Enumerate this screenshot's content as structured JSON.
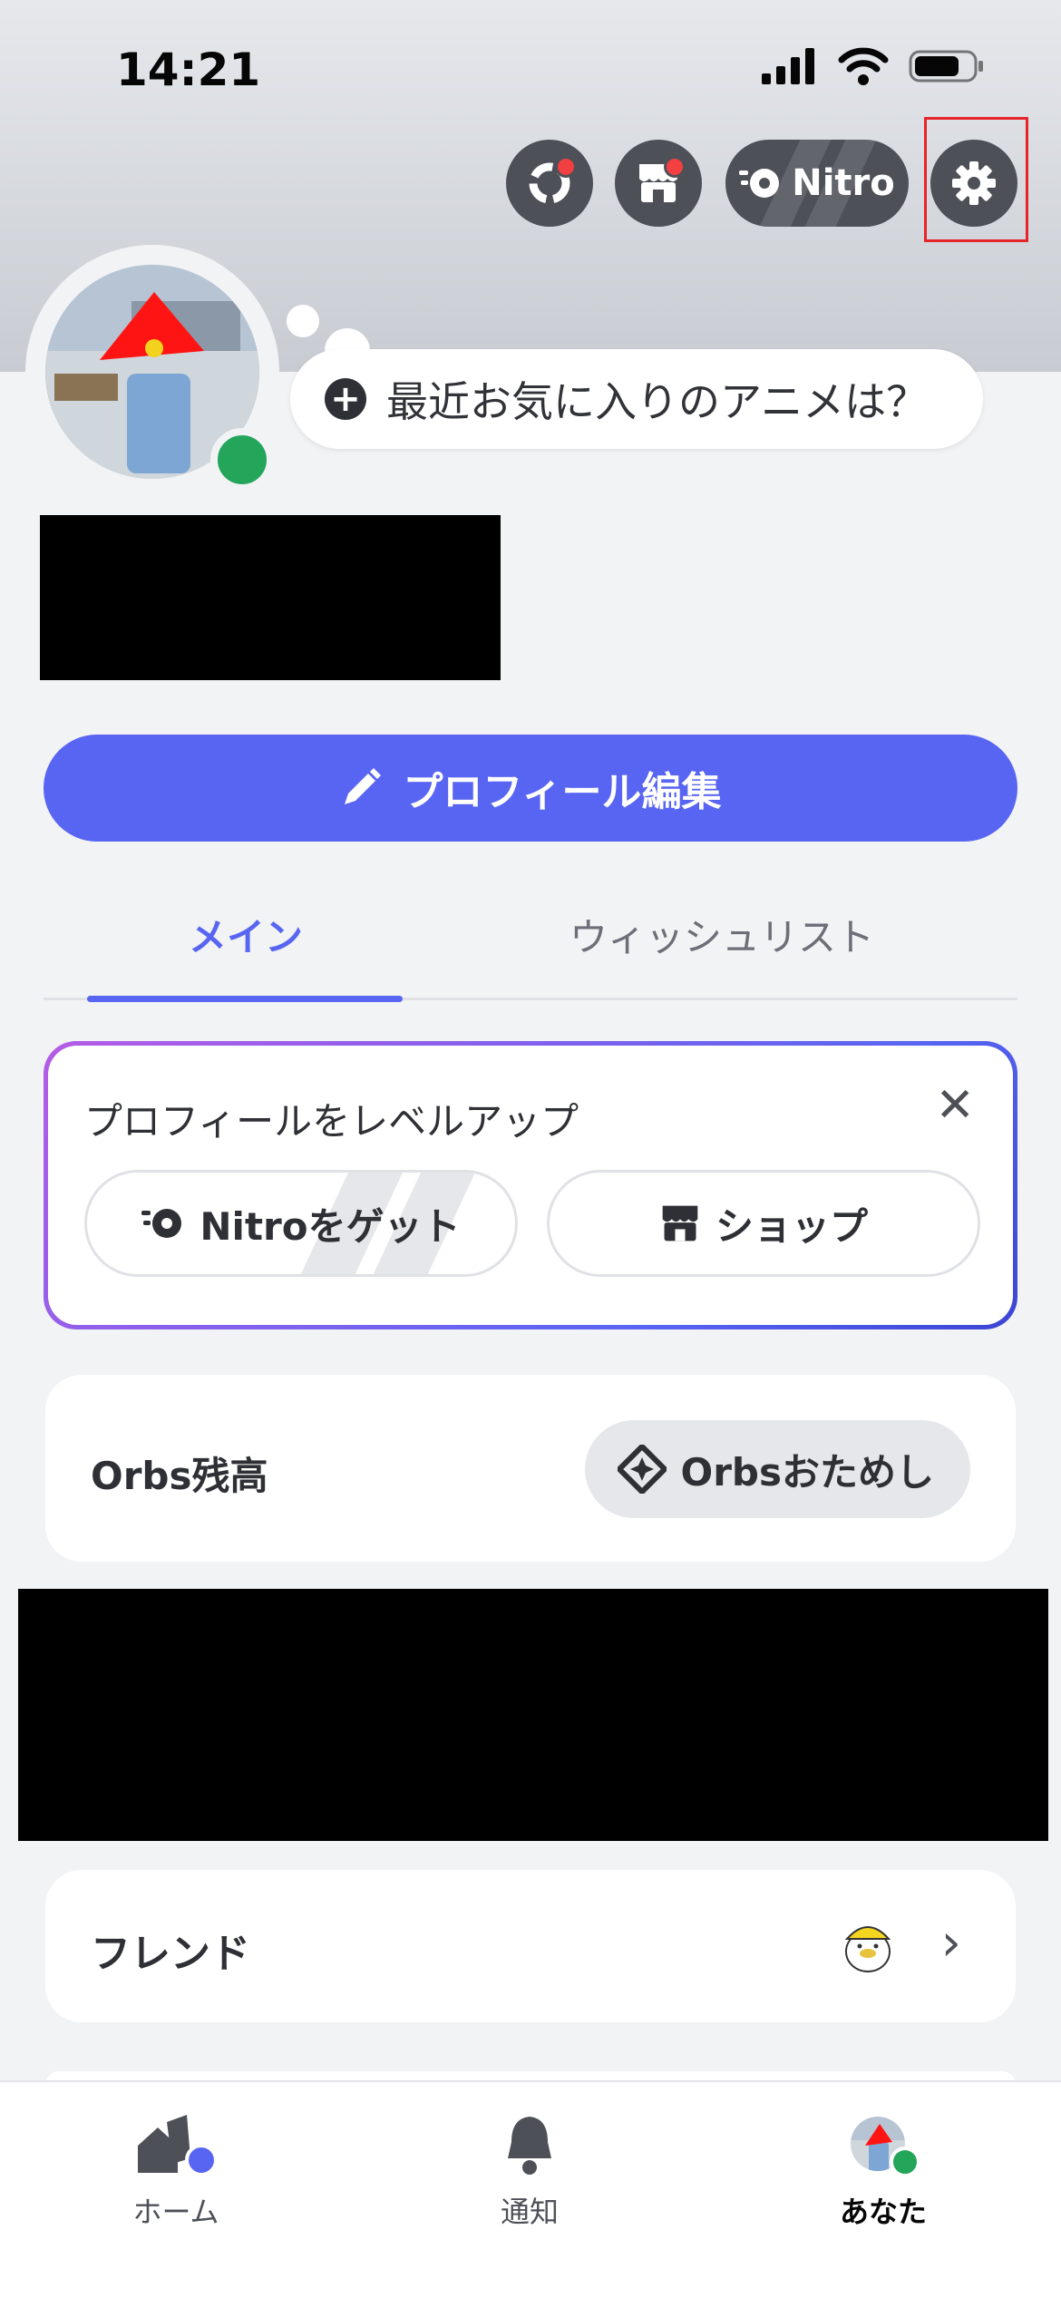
{
  "status_bar": {
    "time": "14:21"
  },
  "header": {
    "nitro_label": "Nitro"
  },
  "profile": {
    "status_prompt": "最近お気に入りのアニメは？",
    "edit_button": "プロフィール編集"
  },
  "tabs": [
    {
      "label": "メイン",
      "active": true
    },
    {
      "label": "ウィッシュリスト",
      "active": false
    }
  ],
  "levelup": {
    "title": "プロフィールをレベルアップ",
    "nitro_button": "Nitroをゲット",
    "shop_button": "ショップ"
  },
  "orbs": {
    "label": "Orbs残高",
    "button": "Orbsおためし"
  },
  "friends": {
    "label": "フレンド"
  },
  "tabbar": [
    {
      "label": "ホーム"
    },
    {
      "label": "通知"
    },
    {
      "label": "あなた"
    }
  ],
  "colors": {
    "brand": "#5865f2",
    "online": "#23a55a",
    "badge": "#f23f42"
  }
}
